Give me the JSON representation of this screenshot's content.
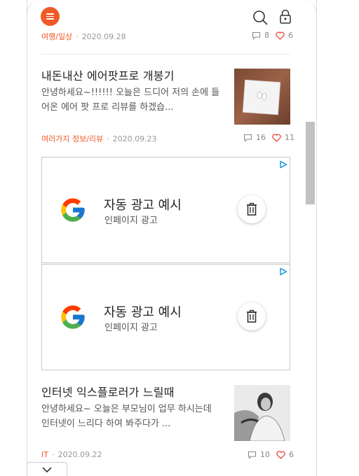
{
  "colors": {
    "accent": "#f05a28",
    "heart": "#e8493b"
  },
  "header": {
    "menu_icon": "hamburger-icon",
    "search_icon": "search-icon",
    "lock_icon": "lock-icon"
  },
  "posts": [
    {
      "category": "여행/일상",
      "date": "2020.09.28",
      "comments": "8",
      "likes": "6"
    },
    {
      "title": "내돈내산 에어팟프로 개봉기",
      "excerpt": "안녕하세요~!!!!!! 오늘은 드디어 저의 손에 들어온 에어 팟 프로 리뷰를 하겠습...",
      "category": "여러가지 정보/리뷰",
      "date": "2020.09.23",
      "comments": "16",
      "likes": "11"
    },
    {
      "title": "인터넷 익스플로러가 느릴때",
      "excerpt": "안녕하세요~ 오늘은 부모님이 업무 하시는데 인터넷이 느리다 하여 봐주다가 ...",
      "category": "IT",
      "date": "2020.09.22",
      "comments": "10",
      "likes": "6"
    }
  ],
  "ads": [
    {
      "title": "자동 광고 예시",
      "subtitle": "인페이지 광고"
    },
    {
      "title": "자동 광고 예시",
      "subtitle": "인페이지 광고"
    }
  ],
  "separator": "·"
}
